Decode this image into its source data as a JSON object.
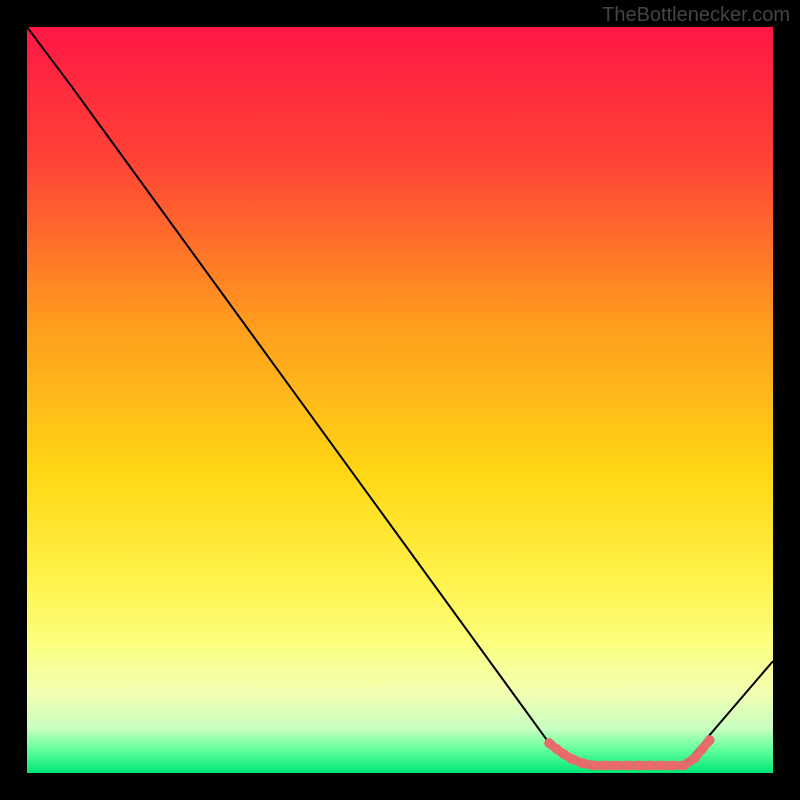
{
  "watermark": "TheBottlenecker.com",
  "chart_data": {
    "type": "line",
    "title": "",
    "xlabel": "",
    "ylabel": "",
    "xlim": [
      0,
      100
    ],
    "ylim": [
      0,
      100
    ],
    "gradient_stops": [
      {
        "offset": 0,
        "color": "#ff1744"
      },
      {
        "offset": 18,
        "color": "#ff4336"
      },
      {
        "offset": 40,
        "color": "#ff9d1e"
      },
      {
        "offset": 60,
        "color": "#ffd814"
      },
      {
        "offset": 74,
        "color": "#fff24a"
      },
      {
        "offset": 82,
        "color": "#fcff7a"
      },
      {
        "offset": 89,
        "color": "#f3ffb0"
      },
      {
        "offset": 94,
        "color": "#c9ffc0"
      },
      {
        "offset": 97,
        "color": "#5eff9a"
      },
      {
        "offset": 100,
        "color": "#00e676"
      }
    ],
    "series": [
      {
        "name": "bottleneck-curve",
        "color": "#000000",
        "points": [
          {
            "x": 0,
            "y": 100
          },
          {
            "x": 6,
            "y": 92
          },
          {
            "x": 70,
            "y": 4
          },
          {
            "x": 75,
            "y": 1
          },
          {
            "x": 88,
            "y": 1
          },
          {
            "x": 100,
            "y": 15
          }
        ]
      }
    ],
    "highlight": {
      "color": "#e86a6a",
      "points": [
        {
          "x": 70,
          "y": 4.0
        },
        {
          "x": 71,
          "y": 3.2
        },
        {
          "x": 72,
          "y": 2.5
        },
        {
          "x": 73,
          "y": 1.9
        },
        {
          "x": 74.5,
          "y": 1.3
        },
        {
          "x": 76,
          "y": 1.0
        },
        {
          "x": 77.5,
          "y": 1.0
        },
        {
          "x": 79,
          "y": 1.0
        },
        {
          "x": 80.5,
          "y": 1.0
        },
        {
          "x": 82,
          "y": 1.0
        },
        {
          "x": 83.5,
          "y": 1.0
        },
        {
          "x": 85,
          "y": 1.0
        },
        {
          "x": 86.5,
          "y": 1.0
        },
        {
          "x": 88,
          "y": 1.0
        },
        {
          "x": 89.5,
          "y": 2.0
        },
        {
          "x": 90.5,
          "y": 3.2
        },
        {
          "x": 91.5,
          "y": 4.4
        }
      ]
    }
  }
}
